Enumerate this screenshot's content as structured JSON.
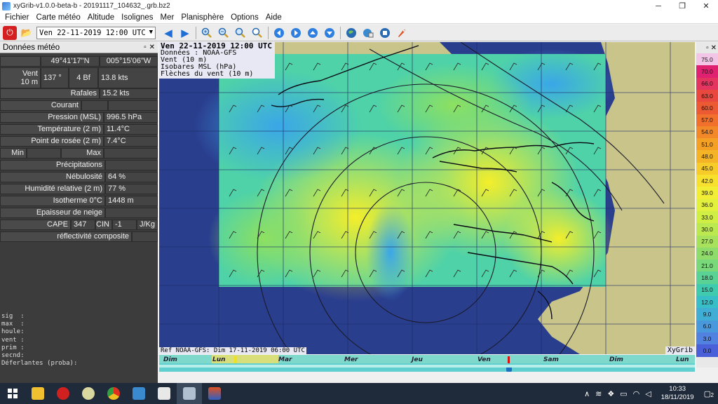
{
  "window": {
    "title": "xyGrib-v1.0.0-beta-b - 20191117_104632_.grb.bz2",
    "minimize": "─",
    "maximize": "❐",
    "close": "✕"
  },
  "menu": [
    "Fichier",
    "Carte météo",
    "Altitude",
    "Isolignes",
    "Mer",
    "Planisphère",
    "Options",
    "Aide"
  ],
  "toolbar": {
    "date_value": "Ven 22-11-2019 12:00 UTC",
    "icons": [
      "power-icon",
      "open-folder-icon",
      "prev-icon",
      "next-icon",
      "zoom-in-icon",
      "zoom-out-icon",
      "zoom-fit-icon",
      "zoom-all-icon",
      "pan-left-icon",
      "pan-right-icon",
      "pan-up-icon",
      "pan-down-icon",
      "globe-icon",
      "download-icon",
      "server-icon",
      "rocket-icon"
    ]
  },
  "panel": {
    "title": "Données météo",
    "float_ctl": "▫",
    "close_ctl": "✕",
    "lat": "49°41'17\"N",
    "lon": "005°15'06\"W",
    "wind_label_1": "Vent",
    "wind_label_2": "10 m",
    "wind_dir": "137 °",
    "wind_bf": "4 Bf",
    "wind_speed": "13.8  kts",
    "gust_label": "Rafales",
    "gust_val": "15.2  kts",
    "current_label": "Courant",
    "pressure_label": "Pression (MSL)",
    "pressure_val": "996.5 hPa",
    "temp_label": "Température (2 m)",
    "temp_val": "11.4°C",
    "dew_label": "Point de rosée (2 m)",
    "dew_val": "7.4°C",
    "min_label": "Min",
    "max_label": "Max",
    "precip_label": "Précipitations",
    "cloud_label": "Nébulosité",
    "cloud_val": "64 %",
    "hum_label": "Humidité relative (2 m)",
    "hum_val": "77 %",
    "iso_label": "Isotherme 0°C",
    "iso_val": "1448 m",
    "snow_label": "Epaisseur de neige",
    "cape_label": "CAPE",
    "cape_val": "347",
    "cin_label": "CIN",
    "cin_val": "-1",
    "cape_unit": "J/Kg",
    "refl_label": "réflectivité composite",
    "log": "sig  :\nmax  :\nhoule:\nvent :\nprim :\nsecnd:\nDéferlantes (proba):"
  },
  "map": {
    "info_date": "Ven 22-11-2019 12:00 UTC",
    "info_data": "Données : NOAA-GFS",
    "info_wind": "Vent (10 m)",
    "info_isobar": "Isobares MSL (hPa)",
    "info_arrows": "Flèches du vent (10 m)",
    "ref_line": "Ref NOAA-GFS: Dim 17-11-2019 06:00 UTC",
    "brand": "XyGrib",
    "colors": {
      "sea": "#2a3e8e",
      "land": "#c8c48a",
      "coast": "#0a0a14"
    }
  },
  "timeline": {
    "days": [
      "Dim",
      "Lun",
      "Mar",
      "Mer",
      "Jeu",
      "Ven",
      "Sam",
      "Dim",
      "Lun"
    ]
  },
  "colorbar": {
    "float_ctl": "▫",
    "close_ctl": "✕",
    "values": [
      "75.0",
      "70.0",
      "66.0",
      "63.0",
      "60.0",
      "57.0",
      "54.0",
      "51.0",
      "48.0",
      "45.0",
      "42.0",
      "39.0",
      "36.0",
      "33.0",
      "30.0",
      "27.0",
      "24.0",
      "21.0",
      "18.0",
      "15.0",
      "12.0",
      "9.0",
      "6.0",
      "3.0",
      "0.0"
    ],
    "colors": [
      "#f2c4e6",
      "#e02070",
      "#e43560",
      "#e8483e",
      "#ec5a34",
      "#f0702c",
      "#f28828",
      "#f4a024",
      "#f5b426",
      "#f7cc2a",
      "#f8e02e",
      "#f2ee36",
      "#e4f03e",
      "#d0ee44",
      "#bce850",
      "#a8e25c",
      "#90dc6a",
      "#78d87a",
      "#5ad296",
      "#40caae",
      "#38bec6",
      "#40aed4",
      "#4a98dc",
      "#5282e0",
      "#4a60d8"
    ]
  },
  "taskbar": {
    "time": "10:33",
    "date": "18/11/2019",
    "notif_count": "2",
    "tray_up": "∧"
  }
}
